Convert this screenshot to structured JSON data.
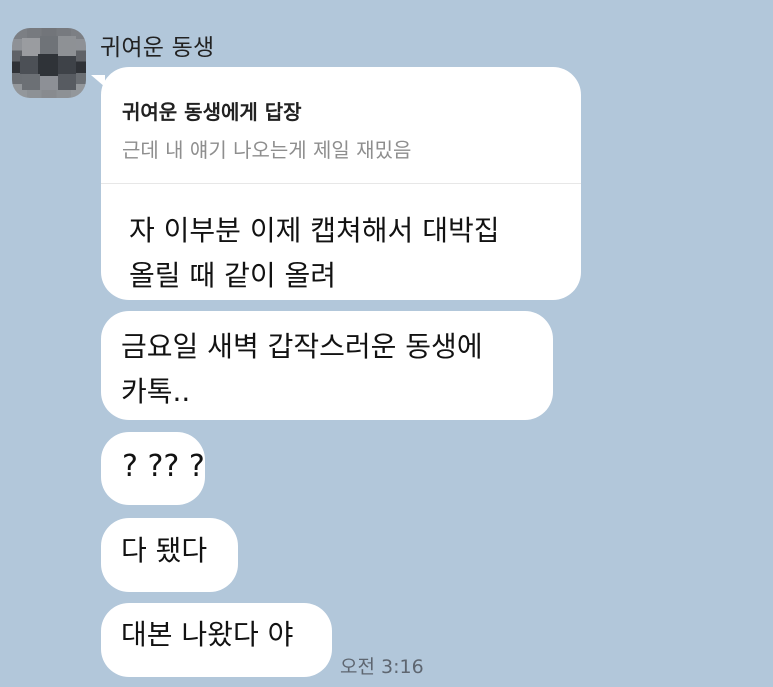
{
  "chat": {
    "sender_name": "귀여운 동생",
    "avatar_icon": "profile-avatar-icon",
    "reply": {
      "title": "귀여운 동생에게 답장",
      "preview": "근데 내 얘기 나오는게 제일 재밌음",
      "message": "자 이부분 이제 캡쳐해서 대박집\n올릴 때 같이 올려"
    },
    "messages": [
      {
        "text": "금요일 새벽 갑작스러운 동생에\n카톡.."
      },
      {
        "text": "? ?? ?"
      },
      {
        "text": "다 됐다"
      },
      {
        "text": "대본 나왔다 야"
      }
    ],
    "time": "오전 3:16"
  },
  "colors": {
    "background": "#b2c7da",
    "bubble": "#ffffff",
    "divider": "#e7e7e7",
    "muted_text": "#8e8e8e"
  }
}
